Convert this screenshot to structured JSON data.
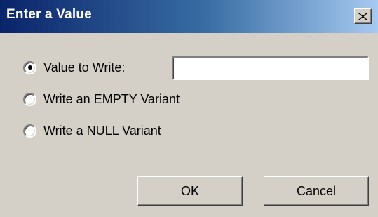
{
  "dialog": {
    "title": "Enter a Value",
    "close_icon": "close-icon"
  },
  "options": {
    "value_to_write_label": "Value to Write:",
    "empty_variant_label": "Write an EMPTY Variant",
    "null_variant_label": "Write a NULL Variant",
    "selected": "value_to_write"
  },
  "value_input": {
    "value": "",
    "placeholder": ""
  },
  "buttons": {
    "ok_label": "OK",
    "cancel_label": "Cancel"
  },
  "colors": {
    "face": "#d4d0c8",
    "title_gradient_start": "#0a246a",
    "title_gradient_end": "#a6caf0"
  }
}
